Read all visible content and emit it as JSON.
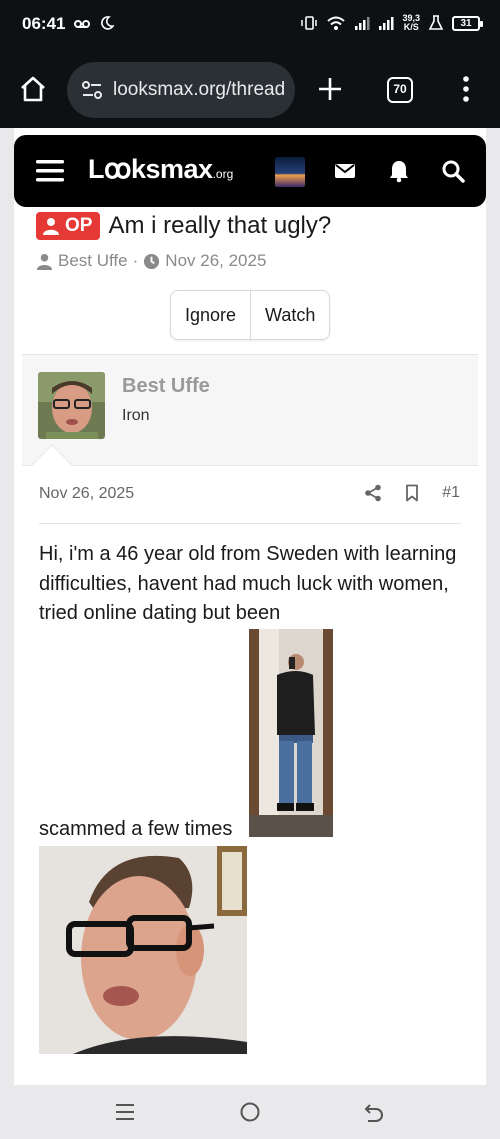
{
  "status_bar": {
    "time": "06:41",
    "left_icons": [
      "voicemail-icon",
      "moon-icon"
    ],
    "speed_value": "39,3",
    "speed_unit": "K/S",
    "battery_level": "31"
  },
  "browser": {
    "url_text": "looksmax.org/thread",
    "tab_count": "70"
  },
  "site": {
    "logo_main": "Lꝏksmax",
    "logo_suffix": ".org"
  },
  "thread": {
    "op_label": "OP",
    "title": "Am i really that ugly?",
    "author": "Best Uffe",
    "separator": "·",
    "date": "Nov 26, 2025",
    "ignore_label": "Ignore",
    "watch_label": "Watch"
  },
  "post": {
    "user_name": "Best Uffe",
    "user_rank": "Iron",
    "date": "Nov 26, 2025",
    "number": "#1",
    "body_text": "Hi, i'm a 46 year old from Sweden with learning difficulties, havent had much luck with women, tried online dating but been",
    "body_end": "scammed a few times"
  },
  "colors": {
    "op_badge": "#e53935",
    "header_bg": "#000000",
    "system_bar": "#0d1114"
  }
}
